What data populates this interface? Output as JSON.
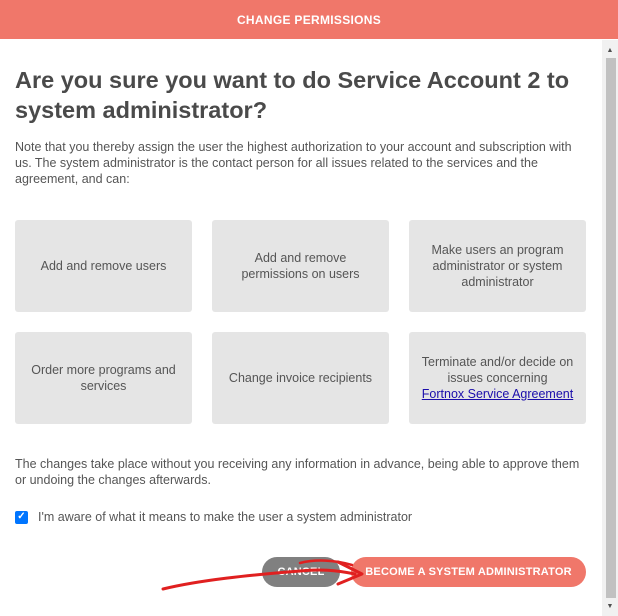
{
  "header": {
    "title": "CHANGE PERMISSIONS"
  },
  "dialog": {
    "question": "Are you sure you want to do Service Account 2 to system administrator?",
    "intro": "Note that you thereby assign the user the highest authorization to your account and subscription with us. The system administrator is the contact person for all issues related to the services and the agreement, and can:",
    "cards": [
      {
        "text": "Add and remove users"
      },
      {
        "text": "Add and remove permissions on users"
      },
      {
        "text": "Make users an program administrator or system administrator"
      },
      {
        "text": "Order more programs and services"
      },
      {
        "text": "Change invoice recipients"
      },
      {
        "text": "Terminate and/or decide on issues concerning",
        "link": "Fortnox Service Agreement"
      }
    ],
    "notice": "The changes take place without you receiving any information in advance, being able to approve them or undoing the changes afterwards.",
    "checkbox": {
      "label": "I'm aware of what it means to make the user a system administrator",
      "checked": true
    },
    "cancel_label": "CANCEL",
    "confirm_label": "BECOME A SYSTEM ADMINISTRATOR"
  },
  "colors": {
    "accent": "#f0776a",
    "cancel": "#808080",
    "checkbox": "#0075ff",
    "annotation_arrow": "#e02020"
  },
  "icons": {
    "scroll_up": "triangle-up",
    "scroll_down": "triangle-down",
    "check": "checkmark"
  }
}
